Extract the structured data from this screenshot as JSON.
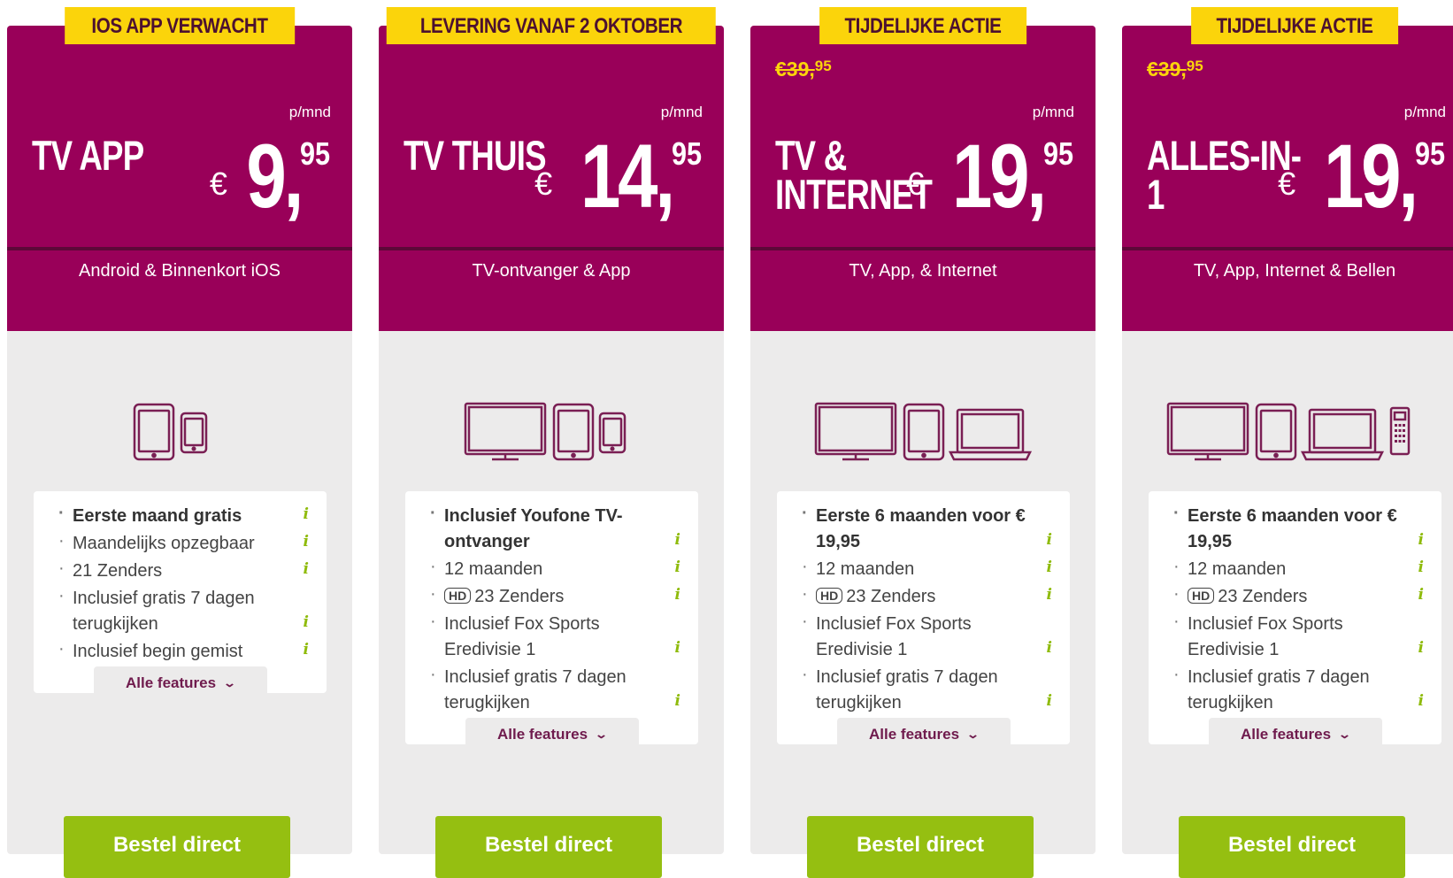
{
  "period_label": "p/mnd",
  "currency_symbol": "€",
  "more_features_label": "Alle features",
  "cta_label": "Bestel direct",
  "colors": {
    "header": "#990059",
    "badge": "#fbd40b",
    "cta": "#95bf11",
    "info": "#8fbb0c",
    "card_body": "#ecebeb"
  },
  "plans": [
    {
      "badge": "IOS APP VERWACHT",
      "old_price": "",
      "old_price_cents": "",
      "title": "TV APP",
      "price_whole": "9,",
      "price_cents": "95",
      "subtitle": "Android & Binnenkort iOS",
      "devices": [
        "tablet-icon",
        "phone-icon"
      ],
      "features": [
        {
          "text": "Eerste maand gratis",
          "bold": true,
          "hd": false
        },
        {
          "text": "Maandelijks opzegbaar",
          "bold": false,
          "hd": false
        },
        {
          "text": "21 Zenders",
          "bold": false,
          "hd": false
        },
        {
          "text": "Inclusief gratis 7 dagen terugkijken",
          "bold": false,
          "hd": false
        },
        {
          "text": "Inclusief begin gemist",
          "bold": false,
          "hd": false
        }
      ]
    },
    {
      "badge": "LEVERING VANAF 2 OKTOBER",
      "old_price": "",
      "old_price_cents": "",
      "title": "TV THUIS",
      "price_whole": "14,",
      "price_cents": "95",
      "subtitle": "TV-ontvanger & App",
      "devices": [
        "tv-icon",
        "tablet-icon",
        "phone-icon"
      ],
      "features": [
        {
          "text": "Inclusief Youfone TV-ontvanger",
          "bold": true,
          "hd": false
        },
        {
          "text": "12 maanden",
          "bold": false,
          "hd": false
        },
        {
          "text": "23 Zenders",
          "bold": false,
          "hd": true
        },
        {
          "text": "Inclusief Fox Sports Eredivisie 1",
          "bold": false,
          "hd": false
        },
        {
          "text": "Inclusief gratis 7 dagen terugkijken",
          "bold": false,
          "hd": false
        }
      ]
    },
    {
      "badge": "TIJDELIJKE ACTIE",
      "old_price": "€39,",
      "old_price_cents": "95",
      "title": "TV & INTERNET",
      "price_whole": "19,",
      "price_cents": "95",
      "subtitle": "TV, App, & Internet",
      "devices": [
        "tv-icon",
        "tablet-icon",
        "laptop-icon"
      ],
      "features": [
        {
          "text": "Eerste 6 maanden voor € 19,95",
          "bold": true,
          "hd": false
        },
        {
          "text": "12 maanden",
          "bold": false,
          "hd": false
        },
        {
          "text": "23 Zenders",
          "bold": false,
          "hd": true
        },
        {
          "text": "Inclusief Fox Sports Eredivisie 1",
          "bold": false,
          "hd": false
        },
        {
          "text": "Inclusief gratis 7 dagen terugkijken",
          "bold": false,
          "hd": false
        }
      ]
    },
    {
      "badge": "TIJDELIJKE ACTIE",
      "old_price": "€39,",
      "old_price_cents": "95",
      "title": "ALLES-IN-1",
      "price_whole": "19,",
      "price_cents": "95",
      "subtitle": "TV, App, Internet & Bellen",
      "devices": [
        "tv-icon",
        "tablet-icon",
        "laptop-icon",
        "deskphone-icon"
      ],
      "features": [
        {
          "text": "Eerste 6 maanden voor € 19,95",
          "bold": true,
          "hd": false
        },
        {
          "text": "12 maanden",
          "bold": false,
          "hd": false
        },
        {
          "text": "23 Zenders",
          "bold": false,
          "hd": true
        },
        {
          "text": "Inclusief Fox Sports Eredivisie 1",
          "bold": false,
          "hd": false
        },
        {
          "text": "Inclusief gratis 7 dagen terugkijken",
          "bold": false,
          "hd": false
        }
      ]
    }
  ]
}
